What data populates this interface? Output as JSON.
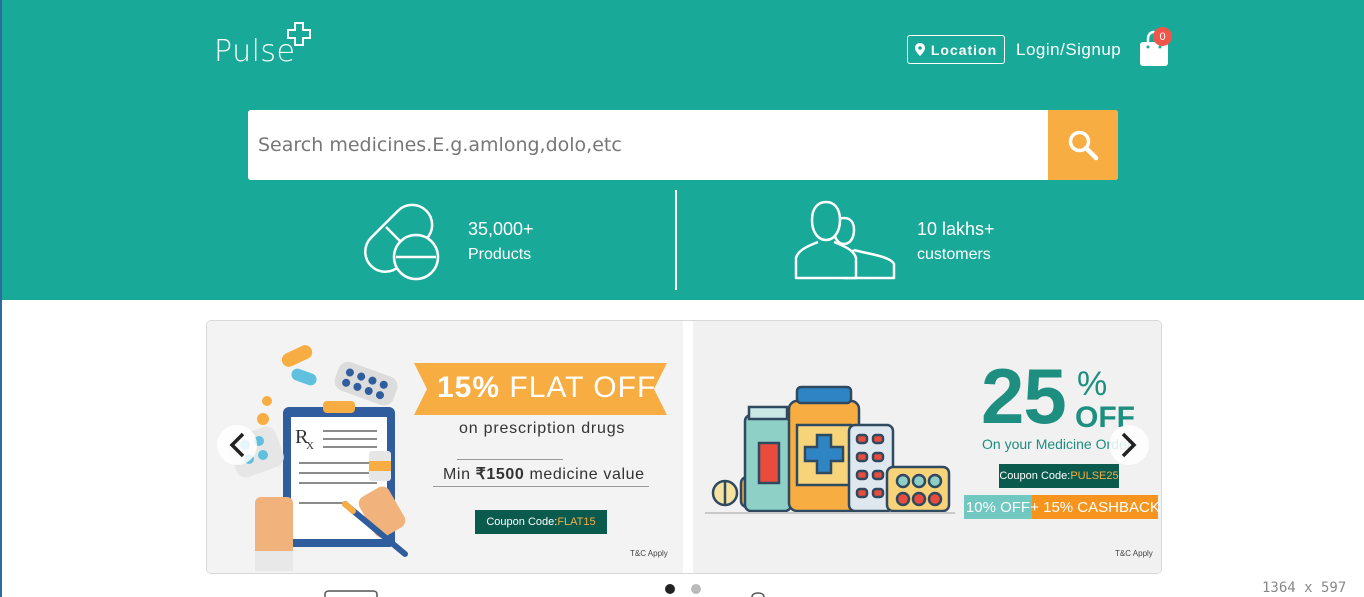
{
  "brand": {
    "name": "Pulse",
    "logo_icon": "plus-cross-icon"
  },
  "header": {
    "location_label": "Location",
    "login_label": "Login/Signup",
    "cart_count": "0"
  },
  "search": {
    "placeholder": "Search medicines.E.g.amlong,dolo,etc",
    "button_icon": "search-icon"
  },
  "stats": [
    {
      "value": "35,000+",
      "label": "Products",
      "icon": "pill-icon"
    },
    {
      "value": "10 lakhs+",
      "label": "customers",
      "icon": "users-icon"
    }
  ],
  "carousel": {
    "slides": [
      {
        "headline_bold": "15%",
        "headline_rest": " FLAT OFF",
        "subtitle": "on prescription drugs",
        "min_prefix": "Min ",
        "min_amount": "₹1500",
        "min_suffix": " medicine value",
        "coupon_label": "Coupon Code: ",
        "coupon_code": "FLAT15",
        "tc": "T&C Apply"
      },
      {
        "big_number": "25",
        "percent": "%",
        "off": "OFF",
        "subtitle": "On your Medicine Order",
        "coupon_label": "Coupon Code: ",
        "coupon_code": "PULSE25",
        "tag1": "10% OFF",
        "tag2": "+ 15% CASHBACK",
        "tc": "T&C Apply"
      }
    ],
    "active_index": 0,
    "dot_count": 2
  },
  "colors": {
    "primary": "#18a999",
    "accent": "#f7ad42",
    "badge": "#f0554a",
    "coupon_bg": "#0a5a4e"
  },
  "screen_size_label": "1364 x 597"
}
